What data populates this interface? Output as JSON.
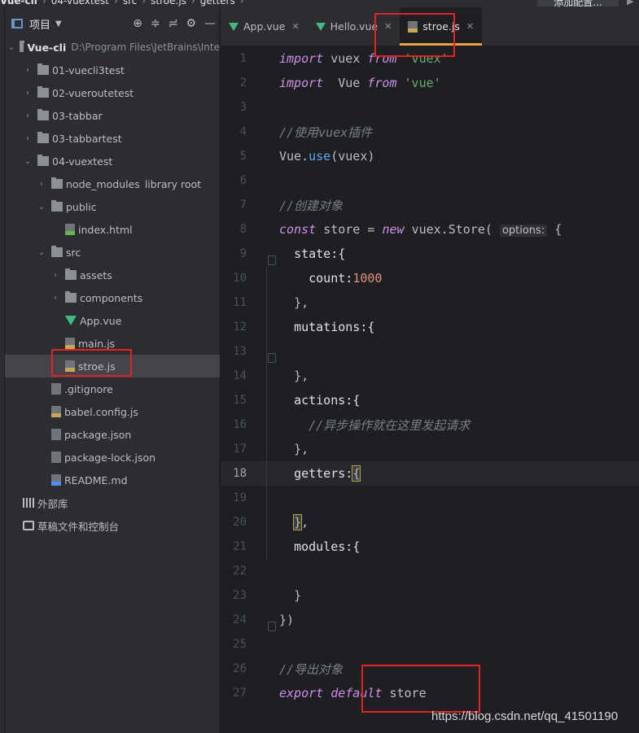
{
  "breadcrumb": {
    "items": [
      "Vue-cli",
      "04-vuextest",
      "src",
      "stroe.js",
      "getters"
    ],
    "right_button": "添加配置..."
  },
  "project_panel": {
    "title": "项目",
    "root": {
      "name": "Vue-cli",
      "path": "D:\\Program Files\\JetBrains\\Inte"
    },
    "items": [
      {
        "label": "01-vuecli3test",
        "type": "folder"
      },
      {
        "label": "02-vueroutetest",
        "type": "folder"
      },
      {
        "label": "03-tabbar",
        "type": "folder"
      },
      {
        "label": "03-tabbartest",
        "type": "folder"
      },
      {
        "label": "04-vuextest",
        "type": "folder"
      },
      {
        "label": "node_modules",
        "extra": "library root",
        "type": "folder"
      },
      {
        "label": "public",
        "type": "folder"
      },
      {
        "label": "index.html",
        "type": "html"
      },
      {
        "label": "src",
        "type": "folder"
      },
      {
        "label": "assets",
        "type": "folder"
      },
      {
        "label": "components",
        "type": "folder"
      },
      {
        "label": "App.vue",
        "type": "vue"
      },
      {
        "label": "main.js",
        "type": "js"
      },
      {
        "label": "stroe.js",
        "type": "js"
      },
      {
        "label": ".gitignore",
        "type": "file"
      },
      {
        "label": "babel.config.js",
        "type": "js"
      },
      {
        "label": "package.json",
        "type": "file"
      },
      {
        "label": "package-lock.json",
        "type": "file"
      },
      {
        "label": "README.md",
        "type": "md"
      },
      {
        "label": "外部库",
        "type": "lib"
      },
      {
        "label": "草稿文件和控制台",
        "type": "console"
      }
    ]
  },
  "tabs": [
    {
      "label": "App.vue",
      "icon": "vue-icon"
    },
    {
      "label": "Hello.vue",
      "icon": "vue-icon"
    },
    {
      "label": "stroe.js",
      "icon": "js-file-icon",
      "active": true
    }
  ],
  "code": {
    "line_numbers": [
      "1",
      "2",
      "3",
      "4",
      "5",
      "6",
      "7",
      "8",
      "9",
      "10",
      "11",
      "12",
      "13",
      "14",
      "15",
      "16",
      "17",
      "18",
      "19",
      "20",
      "21",
      "22",
      "23",
      "24",
      "25",
      "26",
      "27"
    ],
    "tokens": {
      "import": "import",
      "vuex": "vuex",
      "from": "from",
      "str_vuex": "'vuex'",
      "vue_name": "Vue",
      "str_vue": "'vue'",
      "comment_plugin": "//使用vuex插件",
      "vue_use": "Vue.",
      "use": "use",
      "use_arg": "(vuex)",
      "comment_create": "//创建对象",
      "const": "const",
      "store_eq": "store = ",
      "new": "new",
      "vuex_store": "vuex.Store(",
      "options_hint": "options:",
      "open_brace": "{",
      "state": "state:{",
      "count": "count:",
      "count_value": "1000",
      "close_brace_comma": "},",
      "mutations": "mutations:{",
      "actions": "actions:{",
      "comment_async": "//异步操作就在这里发起请求",
      "getters": "getters:",
      "modules": "modules:{",
      "close_brace": "}",
      "close_paren": "})",
      "comment_export": "//导出对象",
      "export": "export",
      "default": "default",
      "store": "store"
    }
  },
  "watermark": "https://blog.csdn.net/qq_41501190",
  "colors": {
    "annotation_red": "#e32323",
    "active_tab_underline": "#e8a33d"
  }
}
